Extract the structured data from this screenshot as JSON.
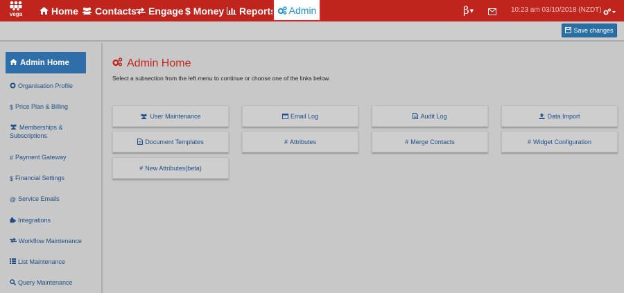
{
  "topbar": {
    "logo_text": "vega",
    "nav": [
      {
        "label": "Home",
        "icon": "home-icon"
      },
      {
        "label": "Contacts",
        "icon": "users-icon"
      },
      {
        "label": "Engage",
        "icon": "exchange-icon"
      },
      {
        "label": "Money",
        "icon": "dollar-icon"
      },
      {
        "label": "Reports",
        "icon": "bar-chart-icon"
      },
      {
        "label": "Admin",
        "icon": "gears-icon"
      }
    ],
    "beta": "β",
    "time": "10:23 am 03/10/2018 (NZDT)"
  },
  "toolbar": {
    "save_label": "Save changes"
  },
  "sidebar": {
    "active": "Admin Home",
    "items": [
      {
        "label": "Organisation Profile",
        "icon": "gear-icon"
      },
      {
        "label": "Price Plan & Billing",
        "icon": "dollar-icon"
      },
      {
        "label": "Memberships & Subscriptions",
        "icon": "users-icon"
      },
      {
        "label": "Payment Gateway",
        "icon": "hash-icon"
      },
      {
        "label": "Financial Settings",
        "icon": "dollar-icon"
      },
      {
        "label": "Service Emails",
        "icon": "at-icon"
      },
      {
        "label": "Integrations",
        "icon": "puzzle-icon"
      },
      {
        "label": "Workflow Maintenance",
        "icon": "exchange-icon"
      },
      {
        "label": "List Maintenance",
        "icon": "list-icon"
      },
      {
        "label": "Query Maintenance",
        "icon": "search-icon"
      }
    ]
  },
  "main": {
    "title": "Admin Home",
    "subtitle": "Select a subsection from the left menu to continue or choose one of the links below.",
    "tiles": [
      {
        "label": "User Maintenance",
        "icon": "users-icon"
      },
      {
        "label": "Email Log",
        "icon": "window-icon"
      },
      {
        "label": "Audit Log",
        "icon": "file-icon"
      },
      {
        "label": "Data Import",
        "icon": "upload-icon"
      },
      {
        "label": "Document Templates",
        "icon": "file-icon"
      },
      {
        "label": "Attributes",
        "icon": "hash-icon"
      },
      {
        "label": "Merge Contacts",
        "icon": "hash-icon"
      },
      {
        "label": "Widget Configuration",
        "icon": "hash-icon"
      },
      {
        "label": "New Attributes(beta)",
        "icon": "hash-icon"
      }
    ]
  }
}
